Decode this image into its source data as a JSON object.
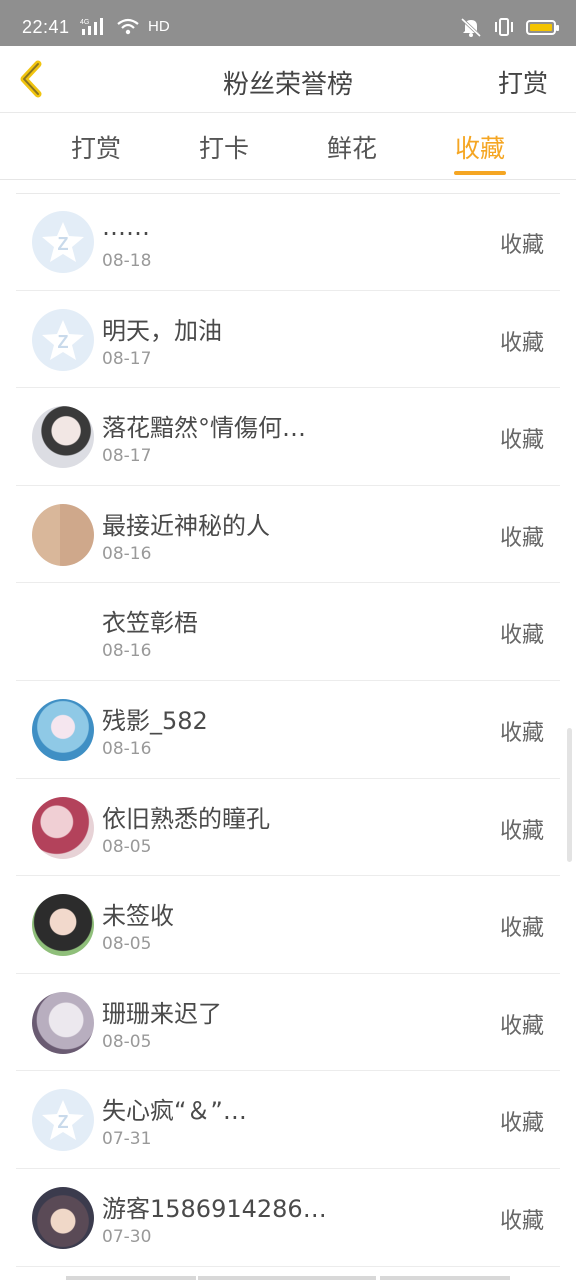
{
  "status_bar": {
    "time": "22:41",
    "network": "4G",
    "hd": "HD"
  },
  "nav": {
    "title": "粉丝荣誉榜",
    "action": "打赏"
  },
  "tabs": [
    {
      "label": "打赏",
      "active": false
    },
    {
      "label": "打卡",
      "active": false
    },
    {
      "label": "鲜花",
      "active": false
    },
    {
      "label": "收藏",
      "active": true
    }
  ],
  "list": [
    {
      "name": "……",
      "date": "08-18",
      "action": "收藏",
      "avatar": "default-avatar"
    },
    {
      "name": "明天，加油",
      "date": "08-17",
      "action": "收藏",
      "avatar": "default-avatar"
    },
    {
      "name": "落花黯然°情傷何…",
      "date": "08-17",
      "action": "收藏",
      "avatar": "photo-avatar"
    },
    {
      "name": "最接近神秘的人",
      "date": "08-16",
      "action": "收藏",
      "avatar": "photo-avatar"
    },
    {
      "name": "衣笠彰梧",
      "date": "08-16",
      "action": "收藏",
      "avatar": "blank"
    },
    {
      "name": "残影_582",
      "date": "08-16",
      "action": "收藏",
      "avatar": "photo-avatar"
    },
    {
      "name": "依旧熟悉的瞳孔",
      "date": "08-05",
      "action": "收藏",
      "avatar": "photo-avatar"
    },
    {
      "name": "未签收",
      "date": "08-05",
      "action": "收藏",
      "avatar": "photo-avatar"
    },
    {
      "name": "珊珊来迟了",
      "date": "08-05",
      "action": "收藏",
      "avatar": "photo-avatar"
    },
    {
      "name": "失心疯“＆”…",
      "date": "07-31",
      "action": "收藏",
      "avatar": "default-avatar"
    },
    {
      "name": "游客1586914286…",
      "date": "07-30",
      "action": "收藏",
      "avatar": "photo-avatar"
    }
  ],
  "colors": {
    "accent": "#f5a623",
    "status_bar_bg": "#8f8f8f",
    "text": "#4a4a4a",
    "muted": "#999999"
  }
}
